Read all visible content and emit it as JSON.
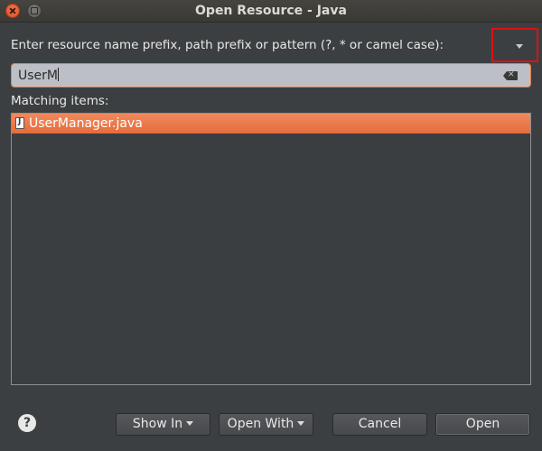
{
  "window": {
    "title": "Open Resource - Java"
  },
  "prompt": {
    "text": "Enter resource name prefix, path prefix or pattern (?, * or camel case):"
  },
  "search": {
    "value": "UserM"
  },
  "matching": {
    "label": "Matching items:",
    "items": [
      {
        "name": "UserManager.java",
        "icon": "java-file-icon",
        "selected": true
      }
    ]
  },
  "buttons": {
    "show_in": "Show In",
    "open_with": "Open With",
    "cancel": "Cancel",
    "open": "Open"
  },
  "colors": {
    "accent": "#e46c3c",
    "background": "#3c3f41",
    "highlight_box": "#e01010"
  }
}
